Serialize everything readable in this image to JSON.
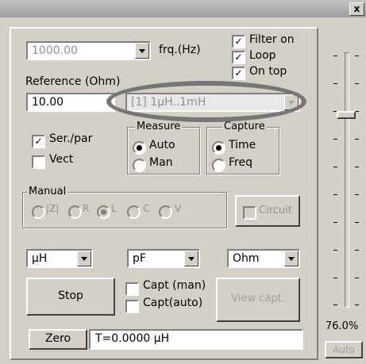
{
  "window": {
    "close_label": "x"
  },
  "frequency": {
    "value": "1000.00",
    "unit_label": "frq.(Hz)"
  },
  "options": {
    "filter_on": {
      "label": "Filter on",
      "checked": true
    },
    "loop": {
      "label": "Loop",
      "checked": true
    },
    "third": {
      "label": "On top",
      "checked": true
    }
  },
  "reference": {
    "label": "Reference (Ohm)",
    "value": "10.00"
  },
  "range": {
    "value": "[1] 1µH..1mH"
  },
  "left_checks": {
    "ser_par": {
      "label": "Ser./par",
      "checked": true
    },
    "vect": {
      "label": "Vect",
      "checked": false
    }
  },
  "measure": {
    "title": "Measure",
    "auto": "Auto",
    "man": "Man",
    "selected": "Auto"
  },
  "capture": {
    "title": "Capture",
    "time": "Time",
    "freq": "Freq",
    "selected": "Time"
  },
  "manual": {
    "title": "Manual",
    "options": [
      "|Z|",
      "R",
      "L",
      "C",
      "V"
    ],
    "selected": "L",
    "circuit_label": "Circuit"
  },
  "units": {
    "inductance": "µH",
    "capacitance": "pF",
    "resistance": "Ohm"
  },
  "buttons": {
    "stop": "Stop",
    "view_capt": "View capt.",
    "zero": "Zero",
    "auto": "Auto"
  },
  "capt_options": {
    "man": {
      "label": "Capt (man)",
      "checked": false
    },
    "auto": {
      "label": "Capt(auto)",
      "checked": false
    }
  },
  "status": {
    "text": "T=0.0000 µH"
  },
  "slider": {
    "percent_label": "76.0%",
    "value": 0.76
  }
}
